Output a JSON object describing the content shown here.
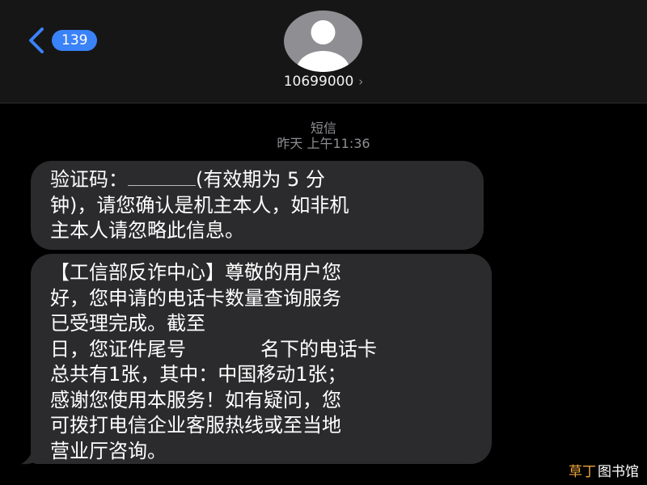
{
  "header": {
    "back_badge": "139",
    "contact_number": "10699000",
    "contact_chevron": "›"
  },
  "thread": {
    "service_label": "短信",
    "timestamp": "昨天 上午11:36"
  },
  "messages": [
    {
      "lines": [
        "验证码：",
        "(有效期为 5 分",
        "钟)，请您确认是机主本人，如非机",
        "主本人请忽略此信息。"
      ]
    },
    {
      "lines": [
        "【工信部反诈中心】尊敬的用户您",
        "好，您申请的电话卡数量查询服务",
        "已受理完成。截至",
        "日，您证件尾号",
        "名下的电话卡",
        "总共有1张，其中：中国移动1张；",
        "感谢您使用本服务！如有疑问，您",
        "可拨打电信企业客服热线或至当地",
        "营业厅咨询。"
      ]
    }
  ],
  "watermark": {
    "part_a": "草丁",
    "part_b": "图书馆"
  },
  "icons": {
    "back": "chevron-left-icon",
    "avatar": "person-icon"
  },
  "colors": {
    "accent": "#3a82f7",
    "bubble": "#2b2b2d",
    "header": "#161616",
    "watermark_a": "#e8a33c"
  }
}
